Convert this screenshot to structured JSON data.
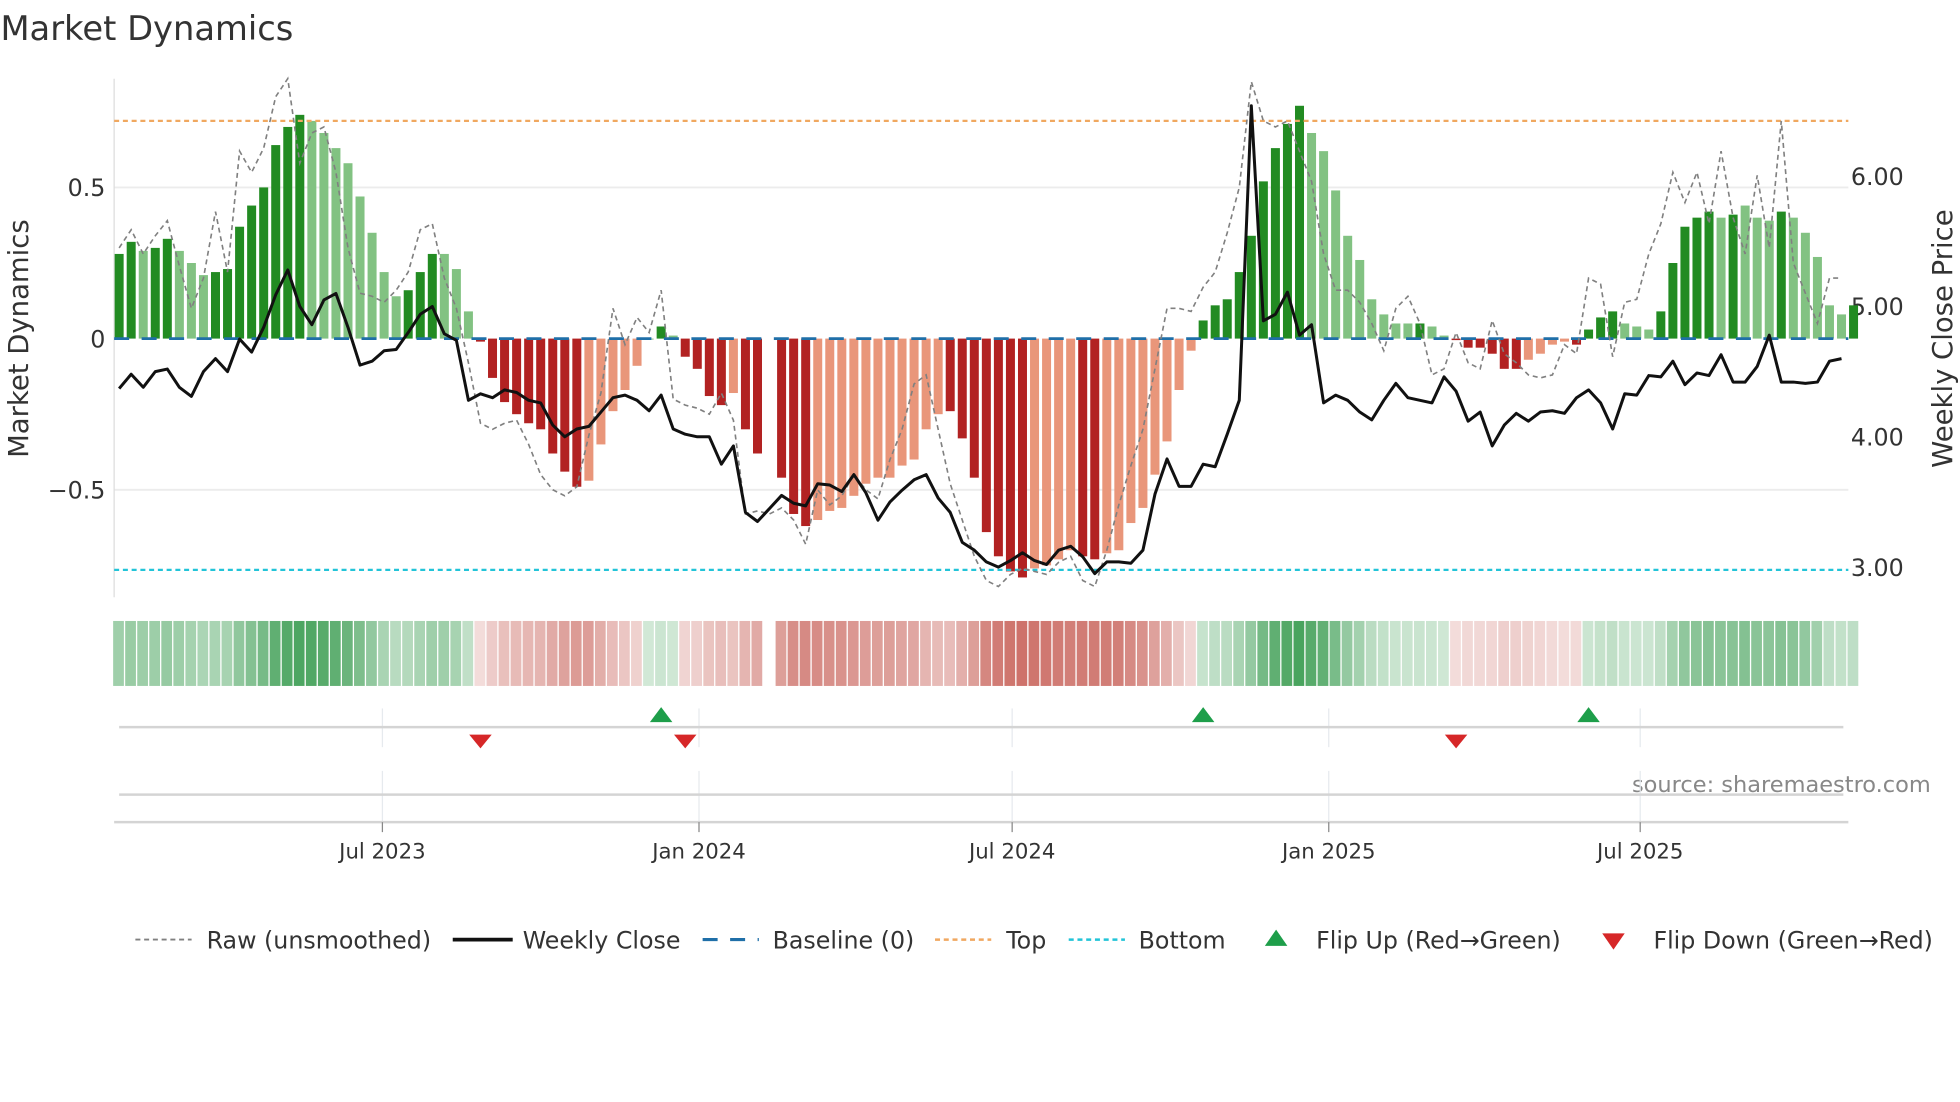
{
  "chart_data": {
    "type": "bar",
    "title": "Market Dynamics",
    "ylabel": "Market Dynamics",
    "ylabel_right": "Weekly Close Price",
    "ylim": [
      -0.86,
      0.86
    ],
    "ylim_right": [
      2.78,
      6.52
    ],
    "yticks": [
      {
        "v": 0.5,
        "label": "0.5"
      },
      {
        "v": 0,
        "label": "0"
      },
      {
        "v": -0.5,
        "label": "−0.5"
      }
    ],
    "yticks_right": [
      {
        "v": 6,
        "label": "6.00"
      },
      {
        "v": 5,
        "label": "5.00"
      },
      {
        "v": 4,
        "label": "4.00"
      },
      {
        "v": 3,
        "label": "3.00"
      }
    ],
    "xticks": [
      {
        "date": "2023-07-01",
        "label": "Jul 2023"
      },
      {
        "date": "2024-01-01",
        "label": "Jan 2024"
      },
      {
        "date": "2024-07-01",
        "label": "Jul 2024"
      },
      {
        "date": "2025-01-01",
        "label": "Jan 2025"
      },
      {
        "date": "2025-07-01",
        "label": "Jul 2025"
      }
    ],
    "start_week": "2023-01-29",
    "frequency": "weekly",
    "top_threshold": 0.72,
    "bottom_threshold": -0.765,
    "baseline": 0,
    "momentum": [
      0.28,
      0.32,
      0.29,
      0.3,
      0.33,
      0.29,
      0.25,
      0.21,
      0.22,
      0.23,
      0.37,
      0.44,
      0.5,
      0.64,
      0.7,
      0.74,
      0.72,
      0.68,
      0.63,
      0.58,
      0.47,
      0.35,
      0.22,
      0.14,
      0.16,
      0.22,
      0.28,
      0.28,
      0.23,
      0.09,
      -0.01,
      -0.13,
      -0.21,
      -0.25,
      -0.28,
      -0.3,
      -0.38,
      -0.44,
      -0.49,
      -0.47,
      -0.35,
      -0.24,
      -0.17,
      -0.09,
      0.0,
      0.04,
      0.01,
      -0.06,
      -0.1,
      -0.19,
      -0.22,
      -0.18,
      -0.3,
      -0.38,
      null,
      -0.46,
      -0.58,
      -0.62,
      -0.6,
      -0.57,
      -0.56,
      -0.52,
      -0.48,
      -0.46,
      -0.46,
      -0.42,
      -0.4,
      -0.3,
      -0.25,
      -0.24,
      -0.33,
      -0.46,
      -0.64,
      -0.72,
      -0.77,
      -0.79,
      -0.76,
      -0.75,
      -0.73,
      -0.7,
      -0.72,
      -0.73,
      -0.71,
      -0.7,
      -0.61,
      -0.56,
      -0.45,
      -0.34,
      -0.17,
      -0.04,
      0.06,
      0.11,
      0.13,
      0.22,
      0.34,
      0.52,
      0.63,
      0.71,
      0.77,
      0.68,
      0.62,
      0.49,
      0.34,
      0.26,
      0.13,
      0.08,
      0.05,
      0.05,
      0.05,
      0.04,
      0.01,
      -0.005,
      -0.03,
      -0.03,
      -0.05,
      -0.1,
      -0.1,
      -0.07,
      -0.05,
      -0.02,
      -0.01,
      -0.02,
      0.03,
      0.07,
      0.09,
      0.05,
      0.04,
      0.03,
      0.09,
      0.25,
      0.37,
      0.4,
      0.42,
      0.4,
      0.41,
      0.44,
      0.4,
      0.39,
      0.42,
      0.4,
      0.35,
      0.27,
      0.11,
      0.08,
      0.11
    ],
    "strong": [
      1,
      1,
      0,
      1,
      1,
      0,
      0,
      0,
      1,
      1,
      1,
      1,
      1,
      1,
      1,
      1,
      0,
      0,
      0,
      0,
      0,
      0,
      0,
      0,
      1,
      1,
      1,
      0,
      0,
      0,
      1,
      1,
      1,
      1,
      1,
      1,
      1,
      1,
      1,
      0,
      0,
      0,
      0,
      0,
      0,
      1,
      0,
      1,
      1,
      1,
      1,
      0,
      1,
      1,
      0,
      1,
      1,
      1,
      0,
      0,
      0,
      0,
      0,
      0,
      0,
      0,
      0,
      0,
      0,
      1,
      1,
      1,
      1,
      1,
      1,
      1,
      0,
      0,
      0,
      0,
      1,
      1,
      0,
      0,
      0,
      0,
      0,
      0,
      0,
      0,
      1,
      1,
      1,
      1,
      1,
      1,
      1,
      1,
      1,
      0,
      0,
      0,
      0,
      0,
      0,
      0,
      0,
      0,
      1,
      0,
      0,
      1,
      1,
      1,
      1,
      1,
      1,
      0,
      0,
      0,
      0,
      1,
      1,
      1,
      1,
      0,
      0,
      0,
      1,
      1,
      1,
      1,
      1,
      0,
      1,
      0,
      0,
      0,
      1,
      0,
      0,
      0,
      0,
      0,
      1
    ],
    "raw": [
      0.3,
      0.36,
      0.28,
      0.34,
      0.39,
      0.24,
      0.1,
      0.2,
      0.42,
      0.22,
      0.62,
      0.55,
      0.63,
      0.8,
      0.86,
      0.58,
      0.68,
      0.7,
      0.55,
      0.3,
      0.15,
      0.14,
      0.12,
      0.16,
      0.22,
      0.36,
      0.38,
      0.2,
      0.1,
      -0.08,
      -0.28,
      -0.3,
      -0.28,
      -0.27,
      -0.35,
      -0.45,
      -0.5,
      -0.52,
      -0.49,
      -0.32,
      -0.18,
      0.1,
      -0.02,
      0.07,
      0.02,
      0.16,
      -0.2,
      -0.22,
      -0.23,
      -0.25,
      -0.18,
      -0.27,
      -0.58,
      -0.57,
      -0.58,
      -0.56,
      -0.6,
      -0.68,
      -0.5,
      -0.55,
      -0.52,
      -0.45,
      -0.5,
      -0.53,
      -0.4,
      -0.3,
      -0.15,
      -0.12,
      -0.3,
      -0.48,
      -0.6,
      -0.72,
      -0.8,
      -0.82,
      -0.78,
      -0.76,
      -0.77,
      -0.78,
      -0.74,
      -0.72,
      -0.8,
      -0.82,
      -0.7,
      -0.55,
      -0.42,
      -0.3,
      -0.1,
      0.1,
      0.1,
      0.09,
      0.17,
      0.22,
      0.35,
      0.5,
      0.85,
      0.72,
      0.7,
      0.72,
      0.62,
      0.52,
      0.28,
      0.16,
      0.16,
      0.12,
      0.05,
      -0.04,
      0.1,
      0.14,
      0.05,
      -0.12,
      -0.1,
      0.02,
      -0.08,
      -0.1,
      0.06,
      -0.05,
      -0.08,
      -0.12,
      -0.13,
      -0.12,
      -0.02,
      -0.05,
      0.2,
      0.18,
      -0.06,
      0.12,
      0.13,
      0.28,
      0.38,
      0.55,
      0.45,
      0.55,
      0.38,
      0.62,
      0.4,
      0.28,
      0.54,
      0.3,
      0.72,
      0.25,
      0.15,
      0.05,
      0.2,
      0.2
    ],
    "weekly_close": [
      4.37,
      4.48,
      4.38,
      4.5,
      4.52,
      4.38,
      4.31,
      4.5,
      4.6,
      4.5,
      4.75,
      4.65,
      4.84,
      5.09,
      5.28,
      5.0,
      4.86,
      5.05,
      5.1,
      4.84,
      4.55,
      4.58,
      4.66,
      4.67,
      4.8,
      4.94,
      5.0,
      4.79,
      4.74,
      4.28,
      4.33,
      4.3,
      4.36,
      4.34,
      4.28,
      4.26,
      4.09,
      4.0,
      4.06,
      4.08,
      4.19,
      4.3,
      4.32,
      4.28,
      4.2,
      4.32,
      4.06,
      4.02,
      4.0,
      4.0,
      3.79,
      3.93,
      3.42,
      3.35,
      3.45,
      3.55,
      3.49,
      3.47,
      3.64,
      3.63,
      3.58,
      3.71,
      3.57,
      3.36,
      3.5,
      3.59,
      3.67,
      3.71,
      3.53,
      3.42,
      3.19,
      3.13,
      3.04,
      3.0,
      3.05,
      3.11,
      3.05,
      3.02,
      3.13,
      3.16,
      3.08,
      2.95,
      3.04,
      3.04,
      3.03,
      3.13,
      3.56,
      3.83,
      3.62,
      3.62,
      3.79,
      3.77,
      4.02,
      4.28,
      6.54,
      4.89,
      4.94,
      5.11,
      4.78,
      4.86,
      4.26,
      4.32,
      4.28,
      4.19,
      4.13,
      4.28,
      4.41,
      4.3,
      4.28,
      4.26,
      4.46,
      4.35,
      4.12,
      4.19,
      3.93,
      4.09,
      4.18,
      4.12,
      4.19,
      4.2,
      4.18,
      4.3,
      4.36,
      4.26,
      4.06,
      4.33,
      4.32,
      4.47,
      4.46,
      4.58,
      4.4,
      4.49,
      4.47,
      4.63,
      4.42,
      4.42,
      4.54,
      4.78,
      4.42,
      4.42,
      4.41,
      4.42,
      4.58,
      4.6
    ],
    "flips_up": [
      "2023-12-10",
      "2024-10-20",
      "2025-06-01"
    ],
    "flips_down": [
      "2023-08-27",
      "2023-12-24",
      "2025-03-16"
    ],
    "legend": {
      "placement": "bottom",
      "entries": [
        {
          "label": "Raw (unsmoothed)",
          "kind": "raw"
        },
        {
          "label": "Weekly Close",
          "kind": "close"
        },
        {
          "label": "Baseline (0)",
          "kind": "baseline"
        },
        {
          "label": "Top",
          "kind": "top"
        },
        {
          "label": "Bottom",
          "kind": "bottom"
        },
        {
          "label": "Flip Up (Red→Green)",
          "kind": "up"
        },
        {
          "label": "Flip Down (Green→Red)",
          "kind": "down"
        }
      ]
    },
    "source": "source: sharemaestro.com",
    "colors": {
      "green_strong": "#228b22",
      "green_weak": "#82c282",
      "red_strong": "#b22222",
      "red_weak": "#e9967a",
      "raw": "#808080",
      "close": "#111111",
      "baseline": "#1f6fa8",
      "top": "#f0a860",
      "bottom": "#22c4d8",
      "flip_up": "#1e9e4a",
      "flip_down": "#d62728"
    }
  }
}
